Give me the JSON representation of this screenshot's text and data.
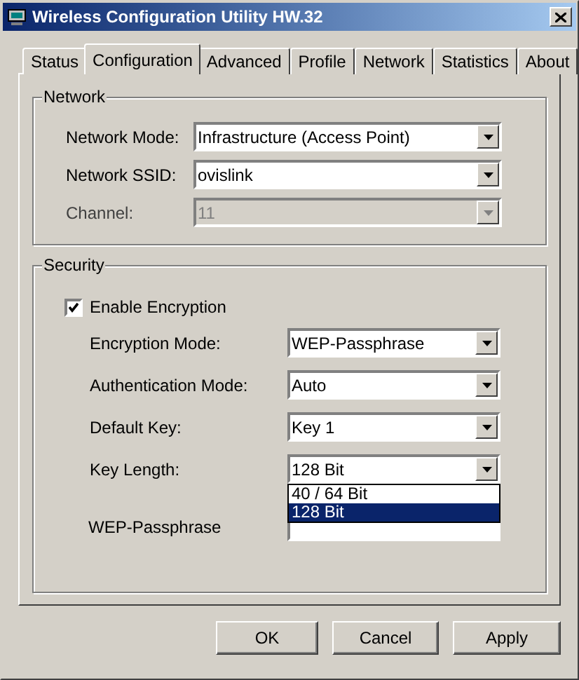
{
  "window": {
    "title": "Wireless Configuration Utility HW.32"
  },
  "tabs": [
    {
      "label": "Status",
      "selected": false
    },
    {
      "label": "Configuration",
      "selected": true
    },
    {
      "label": "Advanced",
      "selected": false
    },
    {
      "label": "Profile",
      "selected": false
    },
    {
      "label": "Network",
      "selected": false
    },
    {
      "label": "Statistics",
      "selected": false
    },
    {
      "label": "About",
      "selected": false
    }
  ],
  "network": {
    "title": "Network",
    "fields": [
      {
        "label": "Network Mode:",
        "value": "Infrastructure (Access Point)",
        "disabled": false
      },
      {
        "label": "Network SSID:",
        "value": "ovislink",
        "disabled": false
      },
      {
        "label": "Channel:",
        "value": "11",
        "disabled": true
      }
    ]
  },
  "security": {
    "title": "Security",
    "encryption": {
      "label": "Enable Encryption",
      "checked": true
    },
    "fields": [
      {
        "label": "Encryption Mode:",
        "value": "WEP-Passphrase"
      },
      {
        "label": "Authentication Mode:",
        "value": "Auto"
      },
      {
        "label": "Default Key:",
        "value": "Key 1"
      },
      {
        "label": "Key Length:",
        "value": "128 Bit",
        "options": [
          {
            "label": "40 / 64 Bit",
            "selected": false
          },
          {
            "label": "128 Bit",
            "selected": true
          }
        ]
      }
    ],
    "passphrase": {
      "label": "WEP-Passphrase"
    }
  },
  "buttons": [
    "OK",
    "Cancel",
    "Apply"
  ]
}
